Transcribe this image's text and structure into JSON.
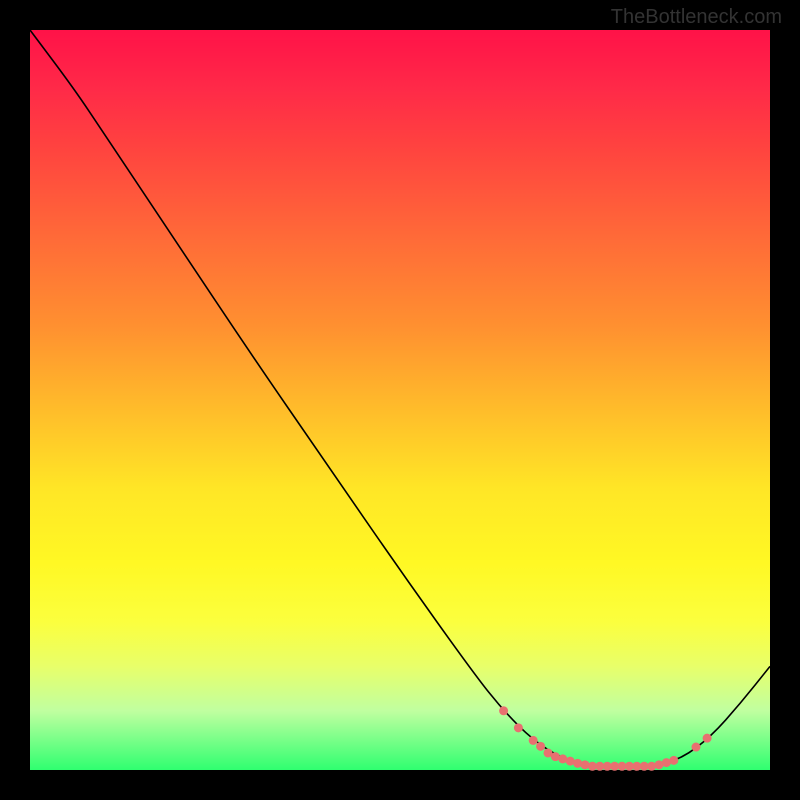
{
  "watermark": "TheBottleneck.com",
  "chart_data": {
    "type": "line",
    "title": "",
    "xlabel": "",
    "ylabel": "",
    "xlim": [
      0,
      100
    ],
    "ylim": [
      0,
      100
    ],
    "curve": [
      {
        "x": 0,
        "y": 100
      },
      {
        "x": 6,
        "y": 92
      },
      {
        "x": 10,
        "y": 86
      },
      {
        "x": 20,
        "y": 71
      },
      {
        "x": 30,
        "y": 56
      },
      {
        "x": 40,
        "y": 41.5
      },
      {
        "x": 50,
        "y": 27
      },
      {
        "x": 60,
        "y": 13
      },
      {
        "x": 64,
        "y": 8
      },
      {
        "x": 68,
        "y": 4
      },
      {
        "x": 72,
        "y": 1.5
      },
      {
        "x": 76,
        "y": 0.5
      },
      {
        "x": 80,
        "y": 0.5
      },
      {
        "x": 84,
        "y": 0.5
      },
      {
        "x": 88,
        "y": 1.5
      },
      {
        "x": 92,
        "y": 4.5
      },
      {
        "x": 96,
        "y": 9
      },
      {
        "x": 100,
        "y": 14
      }
    ],
    "markers": [
      {
        "x": 64,
        "y": 8
      },
      {
        "x": 66,
        "y": 5.7
      },
      {
        "x": 68,
        "y": 4
      },
      {
        "x": 69,
        "y": 3.2
      },
      {
        "x": 70,
        "y": 2.3
      },
      {
        "x": 71,
        "y": 1.8
      },
      {
        "x": 72,
        "y": 1.5
      },
      {
        "x": 73,
        "y": 1.2
      },
      {
        "x": 74,
        "y": 0.9
      },
      {
        "x": 75,
        "y": 0.7
      },
      {
        "x": 76,
        "y": 0.5
      },
      {
        "x": 77,
        "y": 0.5
      },
      {
        "x": 78,
        "y": 0.5
      },
      {
        "x": 79,
        "y": 0.5
      },
      {
        "x": 80,
        "y": 0.5
      },
      {
        "x": 81,
        "y": 0.5
      },
      {
        "x": 82,
        "y": 0.5
      },
      {
        "x": 83,
        "y": 0.5
      },
      {
        "x": 84,
        "y": 0.5
      },
      {
        "x": 85,
        "y": 0.7
      },
      {
        "x": 86,
        "y": 1.0
      },
      {
        "x": 87,
        "y": 1.3
      },
      {
        "x": 90,
        "y": 3.1
      },
      {
        "x": 91.5,
        "y": 4.3
      }
    ],
    "marker_color": "#e87070",
    "gradient": "heat"
  }
}
